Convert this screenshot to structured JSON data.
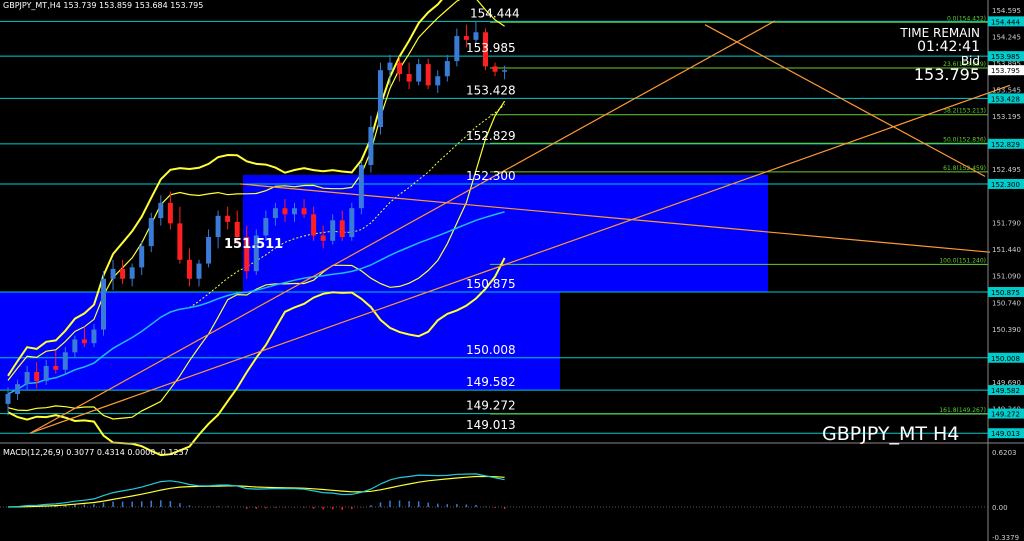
{
  "header": {
    "symbol_info": "GBPJPY_MT,H4  153.739 153.859 153.684 153.795",
    "macd_info": "MACD(12,26,9) 0.3077 0.4314 0.0000 -0.1237"
  },
  "overlay": {
    "time_remain_label": "TIME REMAIN",
    "time_remain_value": "01:42:41",
    "bid_label": "Bid",
    "bid_price": "153.795",
    "symbol_label": "GBPJPY_MT H4",
    "marker_label": "151.511"
  },
  "colors": {
    "bull_candle": "#3a7bd5",
    "bear_candle": "#ff2020",
    "bollinger": "#ffff33",
    "ma_cyan": "#22bbee",
    "trendline_orange": "#ff9933",
    "fib_green": "#66cc33",
    "box_blue": "#0000ff",
    "level_cyan": "#00cccc",
    "macd_signal": "#ffff33",
    "macd_main": "#22ccdd"
  },
  "chart_data": {
    "type": "candlestick",
    "symbol": "GBPJPY_MT",
    "timeframe": "H4",
    "ylim": [
      148.95,
      154.62
    ],
    "price_axis_ticks": [
      "154.595",
      "154.245",
      "153.895",
      "153.545",
      "153.195",
      "152.845",
      "152.495",
      "151.790",
      "151.440",
      "151.090",
      "150.740",
      "150.390",
      "150.040",
      "149.690",
      "149.340"
    ],
    "horizontal_levels": [
      {
        "label": "154.444",
        "value": 154.444
      },
      {
        "label": "153.985",
        "value": 153.985
      },
      {
        "label": "153.428",
        "value": 153.428
      },
      {
        "label": "152.829",
        "value": 152.829
      },
      {
        "label": "152.300",
        "value": 152.3
      },
      {
        "label": "150.875",
        "value": 150.875
      },
      {
        "label": "150.008",
        "value": 150.008
      },
      {
        "label": "149.582",
        "value": 149.582
      },
      {
        "label": "149.272",
        "value": 149.272
      },
      {
        "label": "149.013",
        "value": 149.013
      }
    ],
    "right_axis_level_tags": [
      "154.444",
      "153.985",
      "153.428",
      "152.829",
      "152.300",
      "150.875",
      "150.008",
      "149.582",
      "149.272",
      "149.013"
    ],
    "fibonacci_levels": [
      {
        "label": "0.0(154.432)",
        "value": 154.432
      },
      {
        "label": "23.6(153.829)",
        "value": 153.829
      },
      {
        "label": "38.2(153.213)",
        "value": 153.213
      },
      {
        "label": "50.0(152.836)",
        "value": 152.836
      },
      {
        "label": "61.8(152.459)",
        "value": 152.459
      },
      {
        "label": "100.0(151.240)",
        "value": 151.24
      },
      {
        "label": "161.8(149.267)",
        "value": 149.267
      }
    ],
    "macd": {
      "params": "12,26,9",
      "main": 0.3077,
      "signal": 0.4314,
      "histogram": -0.1237,
      "axis_ticks": [
        "0.6203",
        "0.00",
        "-0.3379"
      ],
      "ylim": [
        -0.3379,
        0.6203
      ]
    },
    "candles": [
      {
        "o": 149.4,
        "h": 149.62,
        "l": 149.25,
        "c": 149.53
      },
      {
        "o": 149.53,
        "h": 149.72,
        "l": 149.45,
        "c": 149.66
      },
      {
        "o": 149.66,
        "h": 149.9,
        "l": 149.58,
        "c": 149.82
      },
      {
        "o": 149.82,
        "h": 149.95,
        "l": 149.6,
        "c": 149.7
      },
      {
        "o": 149.7,
        "h": 149.98,
        "l": 149.65,
        "c": 149.9
      },
      {
        "o": 149.9,
        "h": 150.1,
        "l": 149.8,
        "c": 149.85
      },
      {
        "o": 149.85,
        "h": 150.15,
        "l": 149.8,
        "c": 150.08
      },
      {
        "o": 150.08,
        "h": 150.3,
        "l": 150.0,
        "c": 150.25
      },
      {
        "o": 150.25,
        "h": 150.42,
        "l": 150.15,
        "c": 150.2
      },
      {
        "o": 150.2,
        "h": 150.45,
        "l": 150.15,
        "c": 150.38
      },
      {
        "o": 150.38,
        "h": 151.15,
        "l": 150.3,
        "c": 151.05
      },
      {
        "o": 151.05,
        "h": 151.3,
        "l": 150.9,
        "c": 151.18
      },
      {
        "o": 151.18,
        "h": 151.3,
        "l": 150.98,
        "c": 151.05
      },
      {
        "o": 151.05,
        "h": 151.25,
        "l": 150.95,
        "c": 151.2
      },
      {
        "o": 151.2,
        "h": 151.55,
        "l": 151.1,
        "c": 151.48
      },
      {
        "o": 151.48,
        "h": 151.92,
        "l": 151.4,
        "c": 151.85
      },
      {
        "o": 151.85,
        "h": 152.15,
        "l": 151.75,
        "c": 152.05
      },
      {
        "o": 152.05,
        "h": 152.2,
        "l": 151.7,
        "c": 151.78
      },
      {
        "o": 151.78,
        "h": 152.0,
        "l": 151.25,
        "c": 151.3
      },
      {
        "o": 151.3,
        "h": 151.45,
        "l": 150.95,
        "c": 151.05
      },
      {
        "o": 151.05,
        "h": 151.3,
        "l": 150.95,
        "c": 151.25
      },
      {
        "o": 151.25,
        "h": 151.7,
        "l": 151.2,
        "c": 151.6
      },
      {
        "o": 151.6,
        "h": 151.95,
        "l": 151.45,
        "c": 151.88
      },
      {
        "o": 151.88,
        "h": 152.0,
        "l": 151.7,
        "c": 151.8
      },
      {
        "o": 151.8,
        "h": 151.95,
        "l": 151.5,
        "c": 151.6
      },
      {
        "o": 151.6,
        "h": 151.75,
        "l": 151.05,
        "c": 151.15
      },
      {
        "o": 151.15,
        "h": 151.7,
        "l": 151.1,
        "c": 151.62
      },
      {
        "o": 151.62,
        "h": 151.95,
        "l": 151.55,
        "c": 151.85
      },
      {
        "o": 151.85,
        "h": 152.05,
        "l": 151.75,
        "c": 151.98
      },
      {
        "o": 151.98,
        "h": 152.1,
        "l": 151.8,
        "c": 151.9
      },
      {
        "o": 151.9,
        "h": 152.05,
        "l": 151.8,
        "c": 151.98
      },
      {
        "o": 151.98,
        "h": 152.1,
        "l": 151.85,
        "c": 151.9
      },
      {
        "o": 151.9,
        "h": 152.0,
        "l": 151.55,
        "c": 151.62
      },
      {
        "o": 151.62,
        "h": 151.75,
        "l": 151.45,
        "c": 151.55
      },
      {
        "o": 151.55,
        "h": 151.9,
        "l": 151.5,
        "c": 151.82
      },
      {
        "o": 151.82,
        "h": 151.95,
        "l": 151.55,
        "c": 151.6
      },
      {
        "o": 151.6,
        "h": 152.05,
        "l": 151.55,
        "c": 151.98
      },
      {
        "o": 151.98,
        "h": 152.6,
        "l": 151.9,
        "c": 152.55
      },
      {
        "o": 152.55,
        "h": 153.2,
        "l": 152.45,
        "c": 153.05
      },
      {
        "o": 153.05,
        "h": 153.9,
        "l": 152.95,
        "c": 153.8
      },
      {
        "o": 153.8,
        "h": 154.0,
        "l": 153.6,
        "c": 153.9
      },
      {
        "o": 153.9,
        "h": 153.98,
        "l": 153.65,
        "c": 153.75
      },
      {
        "o": 153.75,
        "h": 153.9,
        "l": 153.55,
        "c": 153.65
      },
      {
        "o": 153.65,
        "h": 153.95,
        "l": 153.6,
        "c": 153.88
      },
      {
        "o": 153.88,
        "h": 153.95,
        "l": 153.55,
        "c": 153.6
      },
      {
        "o": 153.6,
        "h": 153.8,
        "l": 153.5,
        "c": 153.72
      },
      {
        "o": 153.72,
        "h": 154.0,
        "l": 153.65,
        "c": 153.92
      },
      {
        "o": 153.92,
        "h": 154.35,
        "l": 153.85,
        "c": 154.25
      },
      {
        "o": 154.25,
        "h": 154.4,
        "l": 154.1,
        "c": 154.2
      },
      {
        "o": 154.2,
        "h": 154.45,
        "l": 154.15,
        "c": 154.3
      },
      {
        "o": 154.3,
        "h": 154.35,
        "l": 153.8,
        "c": 153.85
      },
      {
        "o": 153.85,
        "h": 153.9,
        "l": 153.72,
        "c": 153.78
      },
      {
        "o": 153.78,
        "h": 153.86,
        "l": 153.68,
        "c": 153.8
      }
    ]
  }
}
